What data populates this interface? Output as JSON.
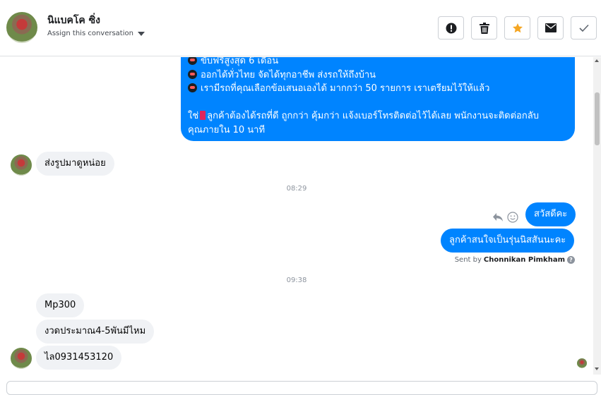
{
  "header": {
    "contact_name": "นิแบคโค ซิ่ง",
    "assign_label": "Assign this conversation",
    "actions": [
      {
        "name": "mark-spam-button",
        "icon": "alert-icon"
      },
      {
        "name": "delete-button",
        "icon": "trash-icon"
      },
      {
        "name": "star-button",
        "icon": "star-icon",
        "color": "#f5a623"
      },
      {
        "name": "mark-unread-button",
        "icon": "envelope-icon"
      },
      {
        "name": "mark-done-button",
        "icon": "check-icon"
      }
    ]
  },
  "thread": {
    "outgoing_long": {
      "lines": [
        "ขับฟรีสูงสุด 6 เดือน",
        "ออกได้ทั่วไทย จัดได้ทุกอาชีพ ส่งรถให้ถึงบ้าน",
        "เรามีรถที่คุณเลือกข้อเสนอเองได้ มากกว่า 50 รายการ เราเตรียมไว้ให้แล้ว",
        "",
        "ใช่",
        "ลูกค้าต้องได้รถที่ดี ถูกกว่า คุ้มกว่า แจ้งเบอร์โทรติดต่อไว้ได้เลย พนักงานจะติดต่อกลับ",
        "คุณภายใน 10 นาที"
      ]
    },
    "incoming_1": "ส่งรูปมาดูหน่อย",
    "time_1": "08:29",
    "outgoing_1": "สวัสดีคะ",
    "outgoing_2": "ลูกค้าสนใจเป็นรุ่นนิสสันนะคะ",
    "sent_by_prefix": "Sent by",
    "sent_by_name": "Chonnikan Pimkham",
    "time_2": "09:38",
    "incoming_2": "Mp300",
    "incoming_3": "งวดประมาณ4-5พันมีไหม",
    "incoming_4": "ไล0931453120"
  },
  "colors": {
    "outgoing_bubble": "#0084ff",
    "incoming_bubble": "#f0f2f5",
    "star": "#f5a623"
  }
}
